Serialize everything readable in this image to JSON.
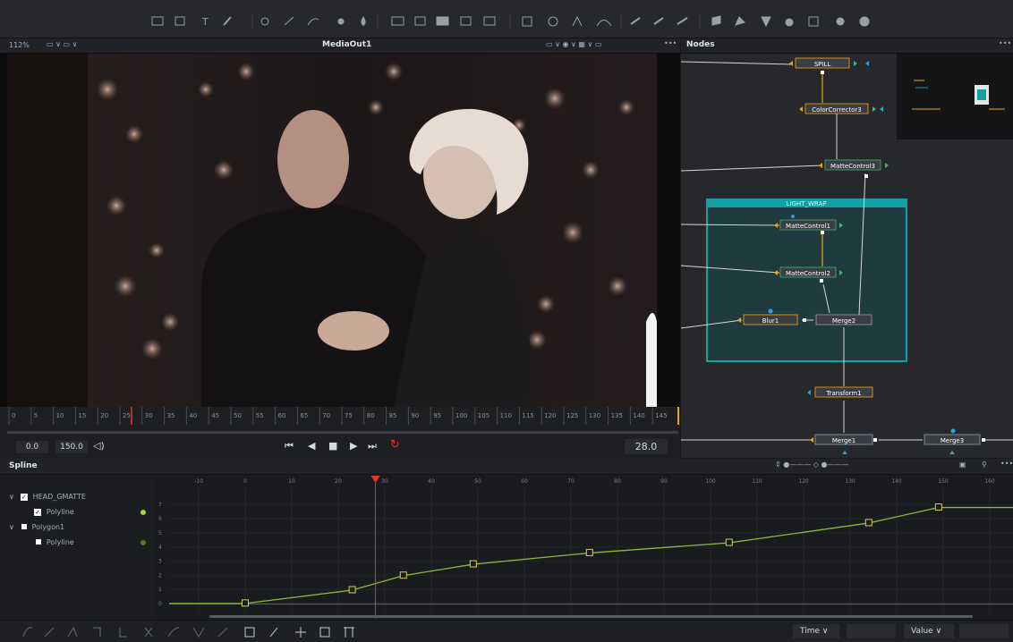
{
  "viewer": {
    "zoom": "112%",
    "title": "MediaOut1",
    "ruler_ticks": [
      "0",
      "5",
      "10",
      "15",
      "20",
      "25",
      "30",
      "35",
      "40",
      "45",
      "50",
      "55",
      "60",
      "65",
      "70",
      "75",
      "80",
      "85",
      "90",
      "95",
      "100",
      "105",
      "110",
      "115",
      "120",
      "125",
      "130",
      "135",
      "140",
      "145"
    ],
    "playhead_frame": 28,
    "range_start": "0.0",
    "range_end": "150.0",
    "current_frame": "28.0"
  },
  "nodes": {
    "title": "Nodes",
    "group_label": "LIGHT_WRAP",
    "labels": {
      "spill": "SPILL",
      "cc3": "ColorCorrector3",
      "mc3": "MatteControl3",
      "mc1": "MatteControl1",
      "mc2": "MatteControl2",
      "blur1": "Blur1",
      "merge2": "Merge2",
      "transform1": "Transform1",
      "merge1": "Merge1",
      "merge3": "Merge3"
    }
  },
  "spline": {
    "title": "Spline",
    "tree": [
      {
        "label": "HEAD_GMATTE",
        "checked": true
      },
      {
        "label": "Polyline",
        "checked": true
      },
      {
        "label": "Polygon1",
        "checked": false
      },
      {
        "label": "Polyline",
        "checked": false
      }
    ],
    "x_ticks": [
      "-10",
      "0",
      "10",
      "20",
      "30",
      "40",
      "50",
      "60",
      "70",
      "80",
      "90",
      "100",
      "110",
      "120",
      "130",
      "140",
      "150",
      "160"
    ],
    "y_ticks": [
      "0",
      "1",
      "2",
      "3",
      "4",
      "5",
      "6",
      "7"
    ],
    "keyframes": [
      [
        0,
        0.01
      ],
      [
        23,
        0.95
      ],
      [
        34,
        1.98
      ],
      [
        49,
        2.78
      ],
      [
        74,
        3.58
      ],
      [
        104,
        4.3
      ],
      [
        134,
        5.7
      ],
      [
        149,
        6.8
      ]
    ],
    "playhead": 28,
    "time_label": "Time",
    "value_label": "Value"
  },
  "colors": {
    "accent": "#e8382e",
    "spline": "#8ab83c",
    "node_border": "#f1a90a",
    "group": "#14a1a4"
  }
}
